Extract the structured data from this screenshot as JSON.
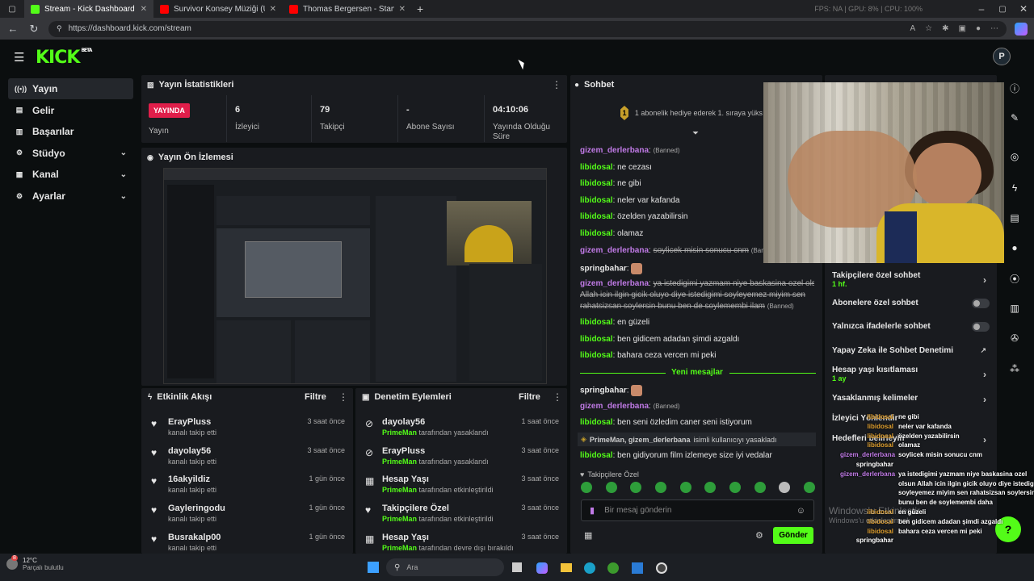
{
  "browser": {
    "tabs": [
      {
        "title": "Stream - Kick Dashboard",
        "active": true,
        "color": "#53fc18"
      },
      {
        "title": "Survivor Konsey Müziği (Uzun Ve",
        "active": false,
        "color": "#ff0000"
      },
      {
        "title": "Thomas Bergersen - Starvati",
        "active": false,
        "color": "#ff0000"
      }
    ],
    "url": "https://dashboard.kick.com/stream",
    "overlay_stats": "FPS: NA | GPU: 8% | CPU: 100%"
  },
  "header": {
    "logo": "KICK",
    "logo_sup": "BETA",
    "avatar_letter": "P"
  },
  "sidebar": {
    "items": [
      {
        "label": "Yayın",
        "icon": "stream-icon",
        "glyph": "((•))",
        "active": true,
        "chevron": false
      },
      {
        "label": "Gelir",
        "icon": "money-icon",
        "glyph": "▤",
        "active": false,
        "chevron": false
      },
      {
        "label": "Başarılar",
        "icon": "trophy-icon",
        "glyph": "▥",
        "active": false,
        "chevron": false
      },
      {
        "label": "Stüdyo",
        "icon": "studio-icon",
        "glyph": "⚙",
        "active": false,
        "chevron": true
      },
      {
        "label": "Kanal",
        "icon": "channel-icon",
        "glyph": "▦",
        "active": false,
        "chevron": true
      },
      {
        "label": "Ayarlar",
        "icon": "settings-icon",
        "glyph": "⚙",
        "active": false,
        "chevron": true
      }
    ]
  },
  "stats": {
    "title": "Yayın İstatistikleri",
    "badge": "YAYINDA",
    "badge_label": "Yayın",
    "cells": [
      {
        "value": "6",
        "label": "İzleyici"
      },
      {
        "value": "79",
        "label": "Takipçi"
      },
      {
        "value": "-",
        "label": "Abone Sayısı"
      },
      {
        "value": "04:10:06",
        "label": "Yayında Olduğu Süre"
      }
    ]
  },
  "preview": {
    "title": "Yayın Ön İzlemesi"
  },
  "activity": {
    "title": "Etkinlik Akışı",
    "filter": "Filtre",
    "rows": [
      {
        "name": "ErayPluss",
        "sub": "kanalı takip etti",
        "time": "3 saat önce"
      },
      {
        "name": "dayolay56",
        "sub": "kanalı takip etti",
        "time": "3 saat önce"
      },
      {
        "name": "16akyildiz",
        "sub": "kanalı takip etti",
        "time": "1 gün önce"
      },
      {
        "name": "Gayleringodu",
        "sub": "kanalı takip etti",
        "time": "1 gün önce"
      },
      {
        "name": "Busrakalp00",
        "sub": "kanalı takip etti",
        "time": "1 gün önce"
      }
    ]
  },
  "moderation": {
    "title": "Denetim Eylemleri",
    "filter": "Filtre",
    "rows": [
      {
        "name": "dayolay56",
        "actor": "PrimeMan",
        "sub": "tarafından yasaklandı",
        "time": "1 saat önce",
        "icon": "ban-icon",
        "glyph": "⊘"
      },
      {
        "name": "ErayPluss",
        "actor": "PrimeMan",
        "sub": "tarafından yasaklandı",
        "time": "3 saat önce",
        "icon": "ban-icon",
        "glyph": "⊘"
      },
      {
        "name": "Hesap Yaşı",
        "actor": "PrimeMan",
        "sub": "tarafından etkinleştirildi",
        "time": "3 saat önce",
        "icon": "calendar-icon",
        "glyph": "▦"
      },
      {
        "name": "Takipçilere Özel",
        "actor": "PrimeMan",
        "sub": "tarafından etkinleştirildi",
        "time": "3 saat önce",
        "icon": "heart-icon",
        "glyph": "♥"
      },
      {
        "name": "Hesap Yaşı",
        "actor": "PrimeMan",
        "sub": "tarafından devre dışı bırakıldı",
        "time": "3 saat önce",
        "icon": "calendar-icon",
        "glyph": "▦"
      }
    ]
  },
  "chat": {
    "title": "Sohbet",
    "pinned": "1 abonelik hediye ederek 1. sıraya yüks",
    "pinned_badge": "1",
    "messages": [
      {
        "user": "gizem_derlerbana",
        "color": "purple",
        "text": "",
        "banned": "(Banned)",
        "strike": false
      },
      {
        "user": "libidosal",
        "color": "green",
        "text": "ne cezası",
        "banned": "",
        "strike": false
      },
      {
        "user": "libidosal",
        "color": "green",
        "text": "ne gibi",
        "banned": "",
        "strike": false
      },
      {
        "user": "libidosal",
        "color": "green",
        "text": "neler var kafanda",
        "banned": "",
        "strike": false
      },
      {
        "user": "libidosal",
        "color": "green",
        "text": "özelden yazabilirsin",
        "banned": "",
        "strike": false
      },
      {
        "user": "libidosal",
        "color": "green",
        "text": "olamaz",
        "banned": "",
        "strike": false
      },
      {
        "user": "gizem_derlerbana",
        "color": "purple",
        "text": "soylicek misin sonucu cnm",
        "banned": "(Banned)",
        "strike": true
      },
      {
        "user": "springbahar",
        "color": "white",
        "text": "",
        "banned": "",
        "strike": false
      },
      {
        "user": "gizem_derlerbana",
        "color": "purple",
        "text": "ya istedigimi yazmam niye baskasina ozel olsun",
        "banned": "",
        "strike": true
      },
      {
        "user": "",
        "color": "white",
        "text": "Allah icin ilgin gicik oluyo diye istedigimi soyleyemez miyim sen",
        "banned": "",
        "strike": true
      },
      {
        "user": "",
        "color": "white",
        "text": "rahatsizsan soylersin bunu ben de soylemembi ilam",
        "banned": "(Banned)",
        "strike": true
      },
      {
        "user": "libidosal",
        "color": "green",
        "text": "en güzeli",
        "banned": "",
        "strike": false
      },
      {
        "user": "libidosal",
        "color": "green",
        "text": "ben gidicem adadan şimdi azgaldı",
        "banned": "",
        "strike": false
      },
      {
        "user": "libidosal",
        "color": "green",
        "text": "bahara ceza vercen mi peki",
        "banned": "",
        "strike": false
      }
    ],
    "new_messages": "Yeni mesajlar",
    "messages2": [
      {
        "user": "springbahar",
        "color": "white",
        "text": "",
        "banned": ""
      },
      {
        "user": "gizem_derlerbana",
        "color": "purple",
        "text": "",
        "banned": "(Banned)"
      },
      {
        "user": "libidosal",
        "color": "green",
        "text": "ben seni özledim caner seni istiyorum",
        "banned": ""
      }
    ],
    "system_msg_users": "PrimeMan, gizem_derlerbana",
    "system_msg_text": "isimli kullanıcıyı yasakladı",
    "last_msg": {
      "user": "libidosal",
      "text": "ben gidiyorum film izlemeye size iyi vedalar"
    },
    "followers_only": "Takipçilere Özel",
    "input_placeholder": "Bir mesaj gönderin",
    "send": "Gönder"
  },
  "settings": {
    "rows": [
      {
        "label": "Takipçilere özel sohbet",
        "sub": "1 hf.",
        "control": "chevron"
      },
      {
        "label": "Abonelere özel sohbet",
        "sub": "",
        "control": "toggle"
      },
      {
        "label": "Yalnızca ifadelerle sohbet",
        "sub": "",
        "control": "toggle"
      },
      {
        "label": "Yapay Zeka ile Sohbet Denetimi",
        "sub": "",
        "control": "external"
      },
      {
        "label": "Hesap yaşı kısıtlaması",
        "sub": "1 ay",
        "control": "chevron"
      },
      {
        "label": "Yasaklanmış kelimeler",
        "sub": "",
        "control": "chevron"
      },
      {
        "label": "İzleyici Yönlendir",
        "sub": "",
        "control": "none"
      },
      {
        "label": "Hedefleri belirleyin",
        "sub": "",
        "control": "chevron"
      }
    ]
  },
  "overlay_chat": [
    {
      "user": "libidosal",
      "text": "ne gibi"
    },
    {
      "user": "libidosal",
      "text": "neler var kafanda"
    },
    {
      "user": "libidosal",
      "text": "özelden yazabilirsin"
    },
    {
      "user": "libidosal",
      "text": "olamaz"
    },
    {
      "user": "gizem_derlerbana",
      "text": "soylicek misin sonucu cnm"
    },
    {
      "user": "springbahar",
      "text": ""
    },
    {
      "user": "gizem_derlerbana",
      "text": "ya istedigimi yazmam niye baskasina ozel"
    },
    {
      "user": "",
      "text": "olsun Allah icin ilgin gicik oluyo diye istedigimi"
    },
    {
      "user": "",
      "text": "soyleyemez miyim sen rahatsizsan soylersin"
    },
    {
      "user": "",
      "text": "bunu ben de soylemembi daha"
    },
    {
      "user": "libidosal",
      "text": "en güzeli"
    },
    {
      "user": "libidosal",
      "text": "ben gidicem adadan şimdi azgaldı"
    },
    {
      "user": "libidosal",
      "text": "bahara ceza vercen mi peki"
    },
    {
      "user": "springbahar",
      "text": ""
    }
  ],
  "overlay_bottom": [
    {
      "text": "ben seni özledim caner seni istiyorum"
    },
    {
      "text": "ben gidiyorum film izlemeye size iyi vedalar"
    }
  ],
  "windows_watermark": {
    "line1": "Windows'u Etkinleştir",
    "line2": "Windows'u etkinleştirmek için Ayarlar'a gidin."
  },
  "taskbar": {
    "temp": "12°C",
    "weather": "Parçalı bulutlu",
    "search": "Ara",
    "notif_count": "8"
  }
}
